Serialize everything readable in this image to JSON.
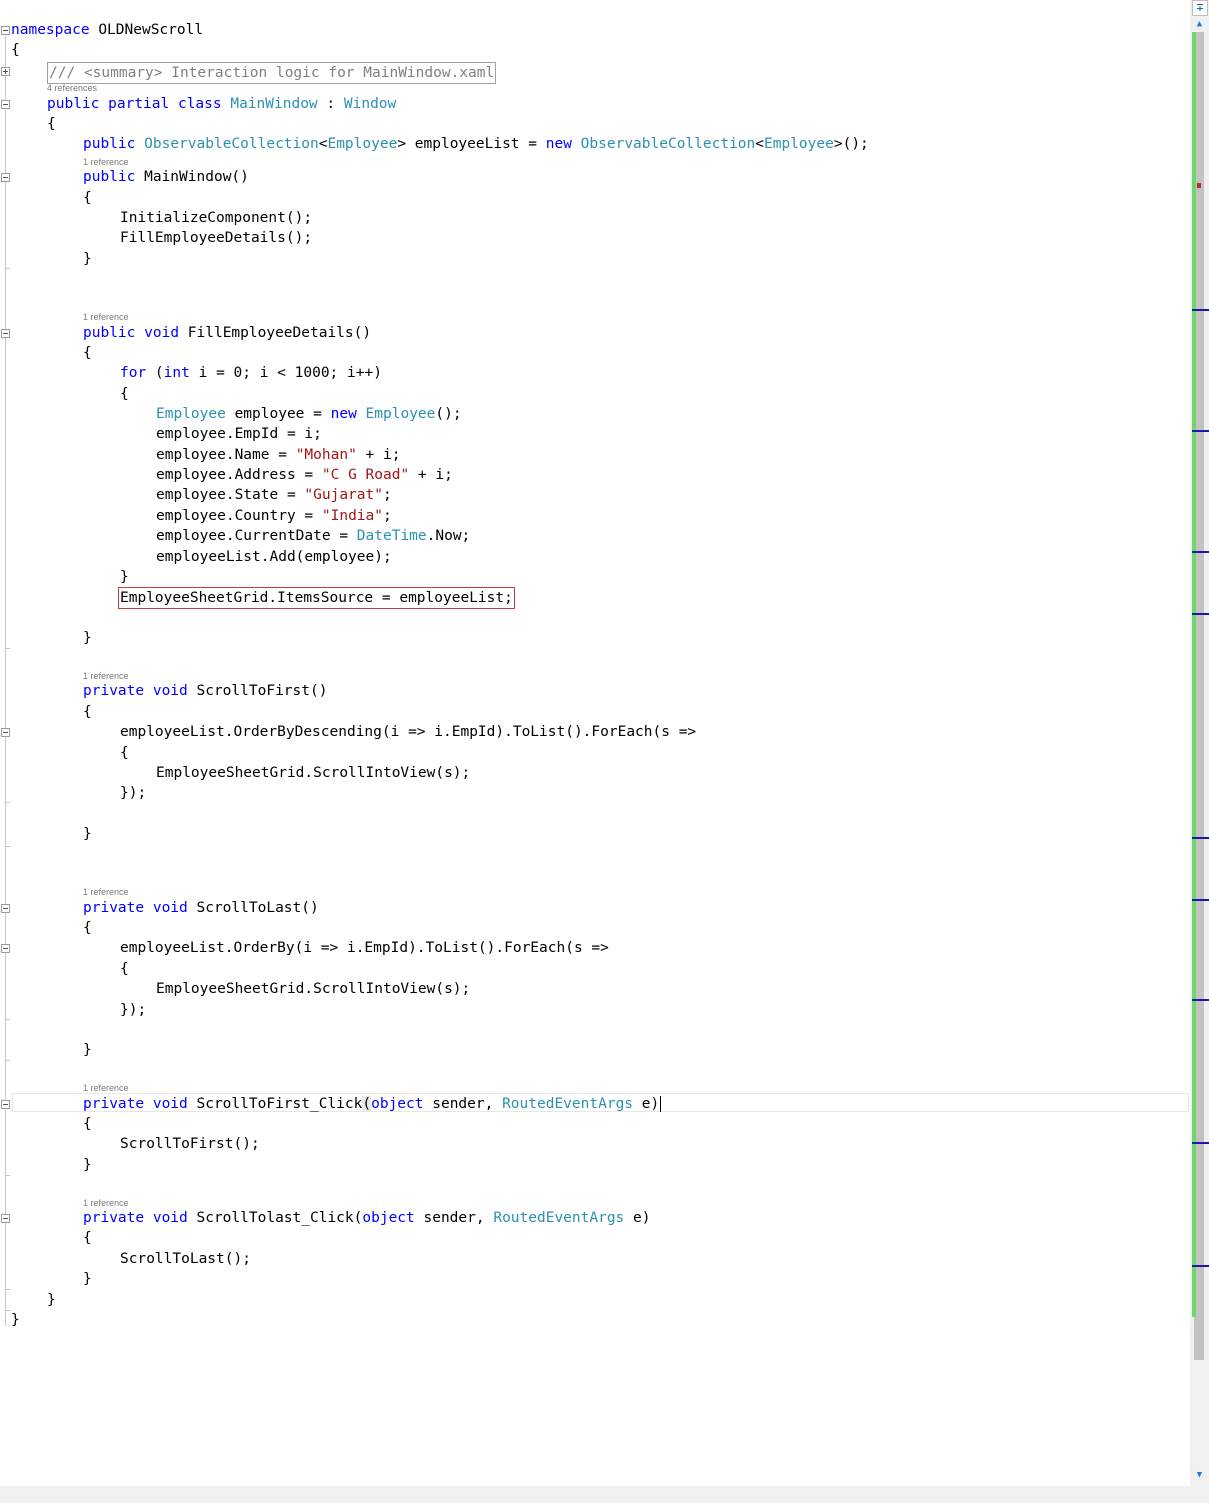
{
  "editor": {
    "namespace_kw": "namespace",
    "namespace_name": "OLDNewScroll",
    "summary_collapsed": "/// <summary> Interaction logic for MainWindow.xaml",
    "lens_4_refs": "4 references",
    "lens_1_ref": "1 reference",
    "class_decl": {
      "public": "public",
      "partial": "partial",
      "class": "class",
      "name": "MainWindow",
      "colon": " : ",
      "base": "Window"
    },
    "field_decl": {
      "public": "public",
      "type1": "ObservableCollection",
      "generic1": "Employee",
      "name": " employeeList = ",
      "new": "new",
      "type2": "ObservableCollection",
      "generic2": "Employee",
      "end": ">();"
    },
    "ctor": {
      "public": "public",
      "sig": " MainWindow()",
      "line1": "InitializeComponent();",
      "line2": "FillEmployeeDetails();"
    },
    "fill": {
      "public": "public",
      "void": "void",
      "sig": " FillEmployeeDetails()",
      "for": "for",
      "int": "int",
      "loop": " i = 0; i < 1000; i++)",
      "emp_type": "Employee",
      "emp_var": " employee = ",
      "new": "new",
      "emp_type2": "Employee",
      "emp_end": "();",
      "empid": "employee.EmpId = i;",
      "name_pre": "employee.Name = ",
      "name_str": "\"Mohan\"",
      "name_post": " + i;",
      "addr_pre": "employee.Address = ",
      "addr_str": "\"C G Road\"",
      "addr_post": " + i;",
      "state_pre": "employee.State = ",
      "state_str": "\"Gujarat\"",
      "state_post": ";",
      "country_pre": "employee.Country = ",
      "country_str": "\"India\"",
      "country_post": ";",
      "date_pre": "employee.CurrentDate = ",
      "date_type": "DateTime",
      "date_post": ".Now;",
      "add": "employeeList.Add(employee);",
      "items_source": "EmployeeSheetGrid.ItemsSource = employeeList;"
    },
    "scroll_first": {
      "private": "private",
      "void": "void",
      "sig": " ScrollToFirst()",
      "linq": "employeeList.OrderByDescending(i => i.EmpId).ToList().ForEach(s =>",
      "body": "EmployeeSheetGrid.ScrollIntoView(s);",
      "close": "});"
    },
    "scroll_last": {
      "private": "private",
      "void": "void",
      "sig": " ScrollToLast()",
      "linq": "employeeList.OrderBy(i => i.EmpId).ToList().ForEach(s =>",
      "body": "EmployeeSheetGrid.ScrollIntoView(s);",
      "close": "});"
    },
    "first_click": {
      "private": "private",
      "void": "void",
      "name": " ScrollToFirst_Click",
      "lparen": "(",
      "object": "object",
      "sender": " sender, ",
      "args_type": "RoutedEventArgs",
      "end": " e)",
      "body": "ScrollToFirst();"
    },
    "last_click": {
      "private": "private",
      "void": "void",
      "name": " ScrollTolast_Click(",
      "object": "object",
      "sender": " sender, ",
      "args_type": "RoutedEventArgs",
      "end": " e)",
      "body": "ScrollToLast();"
    },
    "brace_open": "{",
    "brace_close": "}"
  },
  "colors": {
    "keyword": "#0000ff",
    "type": "#2b91af",
    "string": "#a31515",
    "comment": "#808080",
    "changes": "#6ad86a"
  },
  "icons": {
    "split": "split-icon",
    "up": "scroll-up-arrow-icon",
    "down": "scroll-down-arrow-icon"
  }
}
